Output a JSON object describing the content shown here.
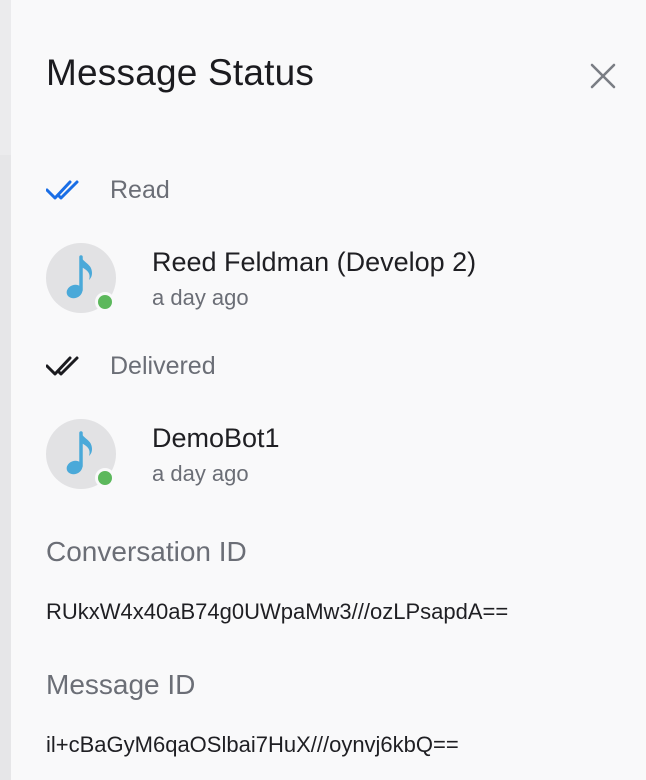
{
  "header": {
    "title": "Message Status",
    "close_icon": "close-icon"
  },
  "read": {
    "label": "Read",
    "icon": "double-check-icon",
    "icon_color": "#1a6ee6",
    "users": [
      {
        "name": "Reed Feldman (Develop 2)",
        "time": "a day ago",
        "avatar_icon": "music-note-icon",
        "status": "online"
      }
    ]
  },
  "delivered": {
    "label": "Delivered",
    "icon": "double-check-icon",
    "icon_color": "#1b1b1f",
    "users": [
      {
        "name": "DemoBot1",
        "time": "a day ago",
        "avatar_icon": "music-note-icon",
        "status": "online"
      }
    ]
  },
  "conversation": {
    "label": "Conversation ID",
    "value": "RUkxW4x40aB74g0UWpaMw3///ozLPsapdA=="
  },
  "message": {
    "label": "Message ID",
    "value": "il+cBaGyM6qaOSlbai7HuX///oynvj6kbQ=="
  },
  "colors": {
    "online": "#5cb85c",
    "note": "#4aa9d9",
    "avatar_bg": "#e2e2e4"
  }
}
